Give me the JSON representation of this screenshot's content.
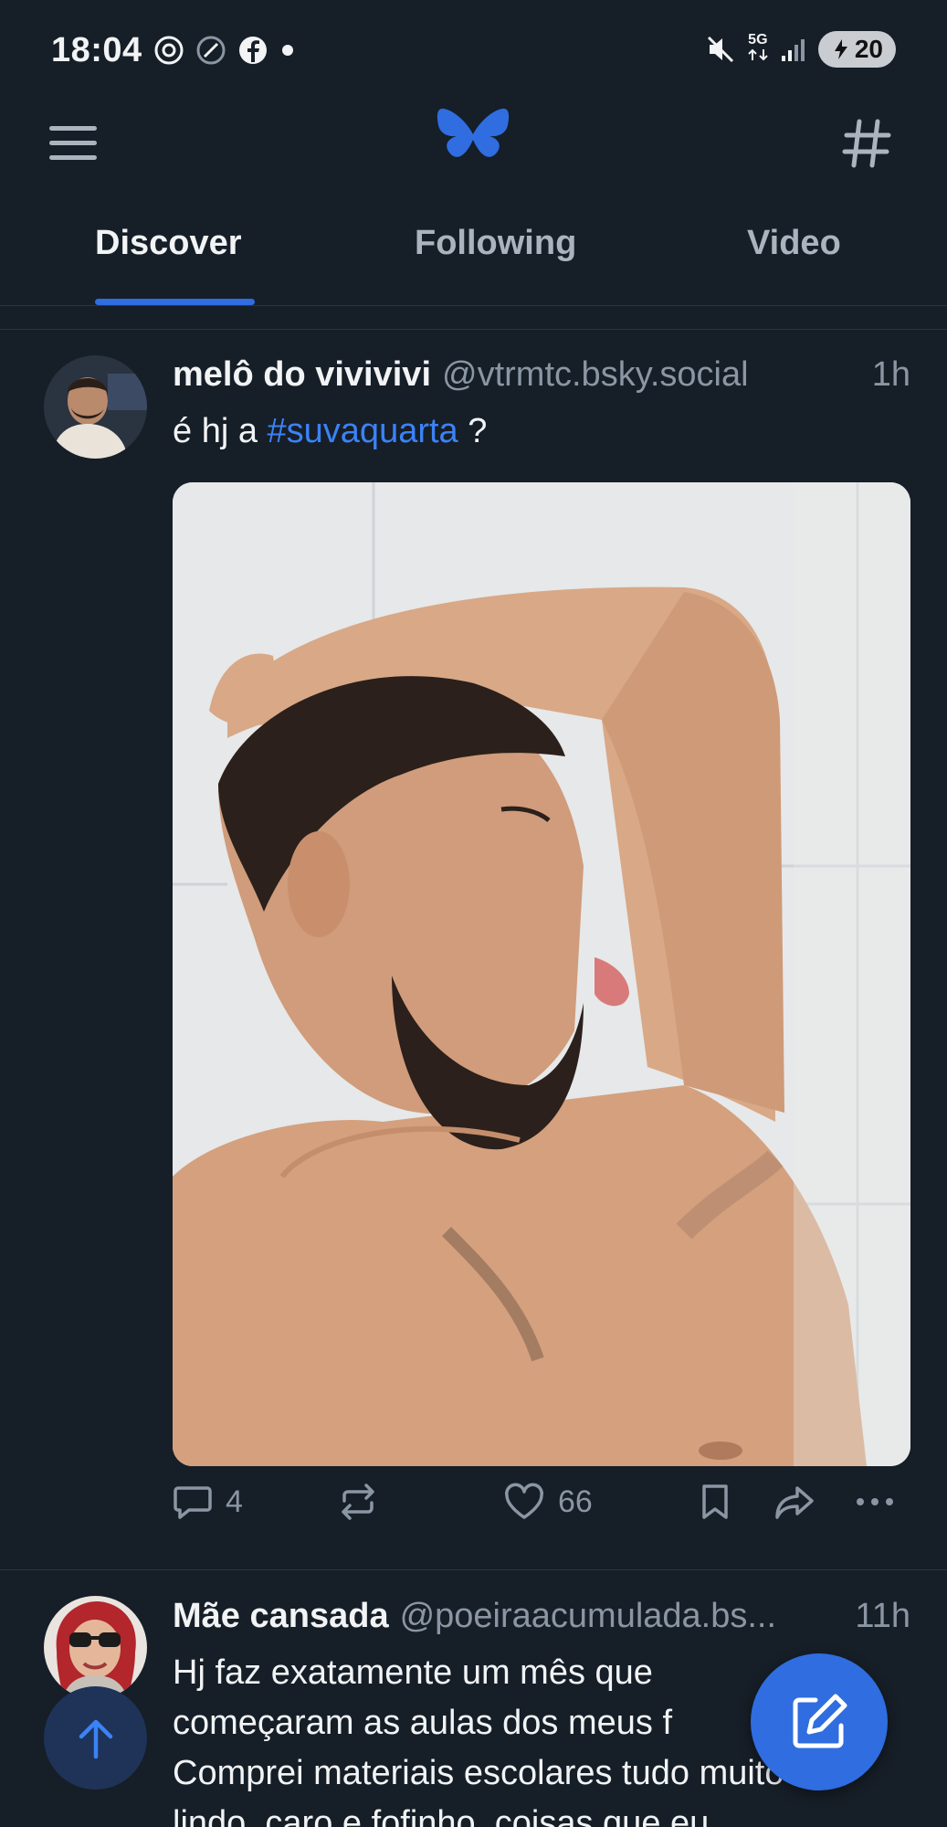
{
  "status_bar": {
    "time": "18:04",
    "network": "5G",
    "battery": "20",
    "icons": [
      "threads-icon",
      "data-saver-icon",
      "facebook-icon",
      "notification-dot-icon",
      "mute-icon",
      "signal-icon"
    ]
  },
  "header": {
    "menu_icon": "menu-icon",
    "logo": "bluesky-butterfly-logo",
    "feeds_icon": "hash-icon"
  },
  "tabs": [
    {
      "label": "Discover",
      "active": true
    },
    {
      "label": "Following",
      "active": false
    },
    {
      "label": "Video",
      "active": false
    }
  ],
  "feed": {
    "posts": [
      {
        "display_name": "melô do vivivivi",
        "handle": "@vtrmtc.bsky.social",
        "time": "1h",
        "text_before": "é hj a ",
        "hashtag": "#suvaquarta",
        "text_after": " ?",
        "media": "photo",
        "reply_count": "4",
        "repost_count": "",
        "like_count": "66"
      },
      {
        "display_name": "Mãe cansada",
        "handle": "@poeiraacumulada.bs...",
        "time": "11h",
        "text_lines": [
          "Hj faz exatamente um mês que",
          "começaram as aulas dos meus f",
          "Comprei materiais escolares tudo muito",
          "lindo, caro e fofinho, coisas que eu"
        ]
      }
    ]
  },
  "colors": {
    "background": "#161e27",
    "accent": "#2f6de0",
    "muted_text": "#8a96a3",
    "divider": "#2b3541"
  }
}
